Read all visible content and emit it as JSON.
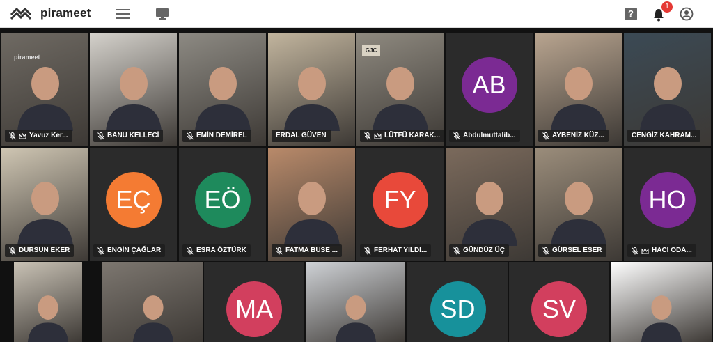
{
  "app": {
    "brand": "pirameet",
    "notification_count": "1"
  },
  "colors": {
    "active_border": "#2f7ef5",
    "badge": "#e53935"
  },
  "tiles": [
    {
      "name": "Yavuz Ker...",
      "initials": "",
      "color": "",
      "muted": true,
      "host": true
    },
    {
      "name": "BANU KELLECİ",
      "initials": "",
      "color": "",
      "muted": true,
      "host": false
    },
    {
      "name": "EMİN DEMİREL",
      "initials": "",
      "color": "",
      "muted": true,
      "host": false
    },
    {
      "name": "ERDAL GÜVEN",
      "initials": "",
      "color": "",
      "muted": false,
      "host": false
    },
    {
      "name": "LÜTFÜ KARAK...",
      "initials": "",
      "color": "",
      "muted": true,
      "host": true,
      "active": true
    },
    {
      "name": "Abdulmuttalib...",
      "initials": "AB",
      "color": "#7b2a93",
      "muted": true,
      "host": false
    },
    {
      "name": "AYBENİZ KÜZ...",
      "initials": "",
      "color": "",
      "muted": true,
      "host": false
    },
    {
      "name": "CENGİZ KAHRAM...",
      "initials": "",
      "color": "",
      "muted": false,
      "host": false
    },
    {
      "name": "DURSUN EKER",
      "initials": "",
      "color": "",
      "muted": true,
      "host": false
    },
    {
      "name": "ENGİN ÇAĞLAR",
      "initials": "EÇ",
      "color": "#f47b33",
      "muted": true,
      "host": false
    },
    {
      "name": "ESRA ÖZTÜRK",
      "initials": "EÖ",
      "color": "#1e8a5c",
      "muted": true,
      "host": false
    },
    {
      "name": "FATMA BUSE ...",
      "initials": "",
      "color": "",
      "muted": true,
      "host": false
    },
    {
      "name": "FERHAT YILDI...",
      "initials": "FY",
      "color": "#e8493a",
      "muted": true,
      "host": false
    },
    {
      "name": "GÜNDÜZ ÜÇ",
      "initials": "",
      "color": "",
      "muted": true,
      "host": false
    },
    {
      "name": "GÜRSEL ESER",
      "initials": "",
      "color": "",
      "muted": true,
      "host": false
    },
    {
      "name": "HACI ODA...",
      "initials": "HO",
      "color": "#7b2a93",
      "muted": true,
      "host": true
    },
    {
      "name": "",
      "initials": "",
      "color": "",
      "muted": false,
      "host": false
    },
    {
      "name": "",
      "initials": "",
      "color": "",
      "muted": false,
      "host": false
    },
    {
      "name": "",
      "initials": "MA",
      "color": "#d23f5e",
      "muted": false,
      "host": false
    },
    {
      "name": "",
      "initials": "",
      "color": "",
      "muted": false,
      "host": false
    },
    {
      "name": "",
      "initials": "SD",
      "color": "#17919b",
      "muted": false,
      "host": false
    },
    {
      "name": "",
      "initials": "SV",
      "color": "#d23f5e",
      "muted": false,
      "host": false
    },
    {
      "name": "",
      "initials": "",
      "color": "",
      "muted": false,
      "host": false
    }
  ],
  "tile_texts": {
    "tile0_logo": "pirameet",
    "tile4_sign": "GJC"
  },
  "icons": {
    "logo": "pirameet-logo-icon",
    "menu": "hamburger-menu-icon",
    "screen": "monitor-icon",
    "help": "help-icon",
    "bell": "bell-icon",
    "user": "user-account-icon",
    "mic": "microphone-icon",
    "crown": "crown-icon"
  },
  "help_glyph": "?"
}
